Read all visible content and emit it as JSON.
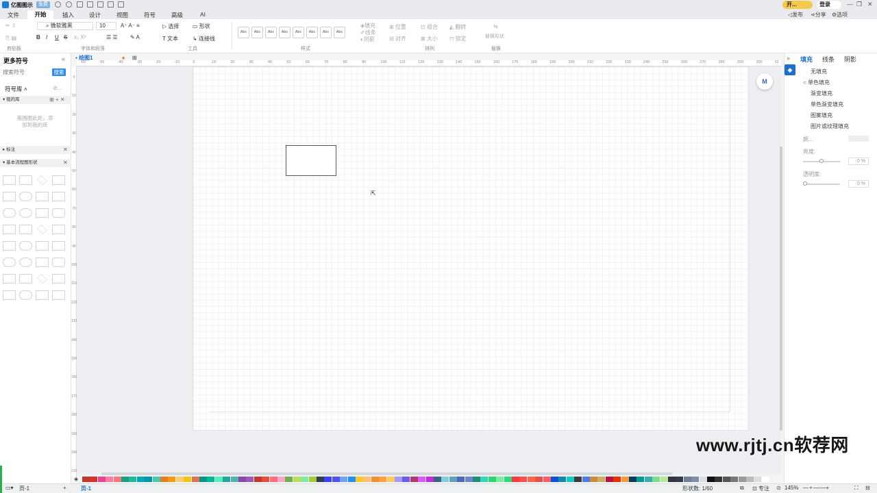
{
  "titlebar": {
    "app_name": "亿图图示",
    "badge": "免费",
    "open_label": "开...",
    "login_label": "登录",
    "window_controls": [
      "—",
      "❐",
      "✕"
    ]
  },
  "menu": {
    "tabs": [
      "文件",
      "开始",
      "插入",
      "设计",
      "视图",
      "符号",
      "高级",
      "AI"
    ],
    "active": "开始",
    "right_actions": [
      "发布",
      "分享",
      "选项"
    ]
  },
  "ribbon": {
    "font_name": "微软雅黑",
    "font_size": "10",
    "select_label": "选择",
    "shape_label": "形状",
    "text_label": "文本",
    "connector_label": "连接线",
    "style_sample": "Abc",
    "fill_label": "填充",
    "line_label": "线条",
    "shadow_label": "阴影",
    "position_label": "位置",
    "group_label": "组合",
    "rotate_label": "翻转",
    "align_label": "对齐",
    "size_label": "大小",
    "lock_label": "锁定",
    "replace_label": "替换形状",
    "groups": {
      "clipboard": "剪贴板",
      "font_para": "字体和段落",
      "tools": "工具",
      "styles": "样式",
      "arrange": "排列",
      "replace": "替换"
    }
  },
  "left_panel": {
    "title": "更多符号",
    "search_placeholder": "搜索符号",
    "search_button": "搜索",
    "library_label": "符号库",
    "my_library": "我的库",
    "drag_hint": "拖拽图此处，添加到我的库",
    "annotation": "标注",
    "basic_shapes": "基本流程图形状"
  },
  "canvas": {
    "doc_tab": "绘图1",
    "ruler_h": [
      "-60",
      "-50",
      "-40",
      "-30",
      "-20",
      "-10",
      "0",
      "10",
      "20",
      "30",
      "40",
      "50",
      "60",
      "70",
      "80",
      "90",
      "100",
      "110",
      "120",
      "130",
      "140",
      "150",
      "160",
      "170",
      "180",
      "190",
      "200",
      "210",
      "220",
      "230",
      "240",
      "250",
      "260",
      "270",
      "280",
      "290",
      "300",
      "31"
    ],
    "ruler_v": [
      "0",
      "10",
      "20",
      "30",
      "40",
      "50",
      "60",
      "70",
      "80",
      "90",
      "100",
      "110",
      "120",
      "130",
      "140",
      "150",
      "160",
      "170",
      "180",
      "190",
      "200",
      "210"
    ]
  },
  "right_panel": {
    "tabs": [
      "填充",
      "线条",
      "阴影"
    ],
    "fill_options": [
      "无填充",
      "单色填充",
      "渐变填充",
      "单色渐变填充",
      "图案填充",
      "图片或纹理填充"
    ],
    "color_label": "颜...",
    "brightness_label": "亮度:",
    "brightness_value": "0 %",
    "brightness_level": 0.5,
    "transparency_label": "透明度:",
    "transparency_value": "0 %",
    "transparency_level": 0
  },
  "palette": [
    "#c0392b",
    "#d63031",
    "#e84393",
    "#fd79a8",
    "#ff7675",
    "#16a085",
    "#1abc9c",
    "#00a8b5",
    "#0097a7",
    "#48c9b0",
    "#e67e22",
    "#f39c12",
    "#fdcb6e",
    "#f1c40f",
    "#e17055",
    "#009688",
    "#00b894",
    "#55efc4",
    "#26a69a",
    "#4db6ac",
    "#8e44ad",
    "#9b59b6",
    "#c0392b",
    "#e74c3c",
    "#ff6b81",
    "#f8a5c2",
    "#6ab04c",
    "#badc58",
    "#7bed9f",
    "#a3cb38",
    "#2c3e50",
    "#3742fa",
    "#5352ed",
    "#70a1ff",
    "#1e90ff",
    "#f9ca24",
    "#ffbe76",
    "#f0932b",
    "#ff9f43",
    "#feca57",
    "#a29bfe",
    "#6c5ce7",
    "#b33771",
    "#e056fd",
    "#be2edd",
    "#3c6382",
    "#82ccdd",
    "#60a3bc",
    "#4a69bd",
    "#6a89cc",
    "#218c74",
    "#33d9b2",
    "#2ed573",
    "#7bed9f",
    "#26de81",
    "#ff3838",
    "#ff4d4d",
    "#ff6348",
    "#eb4d4b",
    "#fc5c65",
    "#0652dd",
    "#1289a7",
    "#12cbc4",
    "#3d3d3d",
    "#4b7bec",
    "#cc8e35",
    "#ccae62",
    "#b71540",
    "#eb2f06",
    "#fa983a",
    "#0a3d62",
    "#079992",
    "#38ada9",
    "#78e08f",
    "#b8e994",
    "#2f3640",
    "#353b48",
    "#718093",
    "#7f8fa6",
    "#dcdde1",
    "#111111",
    "#333333",
    "#555555",
    "#777777",
    "#999999",
    "#bbbbbb",
    "#dddddd",
    "#ffffff"
  ],
  "statusbar": {
    "page_label": "页-1",
    "active_page": "页-1",
    "shape_count": "形状数: 1/60",
    "focus_label": "专注",
    "zoom": "145%"
  },
  "watermark": "www.rjtj.cn软荐网"
}
